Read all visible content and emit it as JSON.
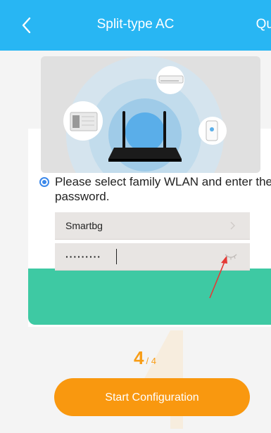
{
  "header": {
    "title": "Split-type AC",
    "quit_label": "Qu"
  },
  "hero": {
    "devices": [
      "window-ac-icon",
      "split-ac-icon",
      "wall-unit-icon"
    ],
    "router": "wifi-router-icon"
  },
  "network": {
    "prompt": "Please select family WLAN and enter the password.",
    "wifi_name": "Smartbg",
    "password_masked": "·········"
  },
  "progress": {
    "current": "4",
    "total": "4"
  },
  "actions": {
    "start_label": "Start Configuration"
  },
  "colors": {
    "header": "#28b6f3",
    "accent_green": "#3ec9a3",
    "button": "#f9980f",
    "radio": "#3b88ea"
  }
}
